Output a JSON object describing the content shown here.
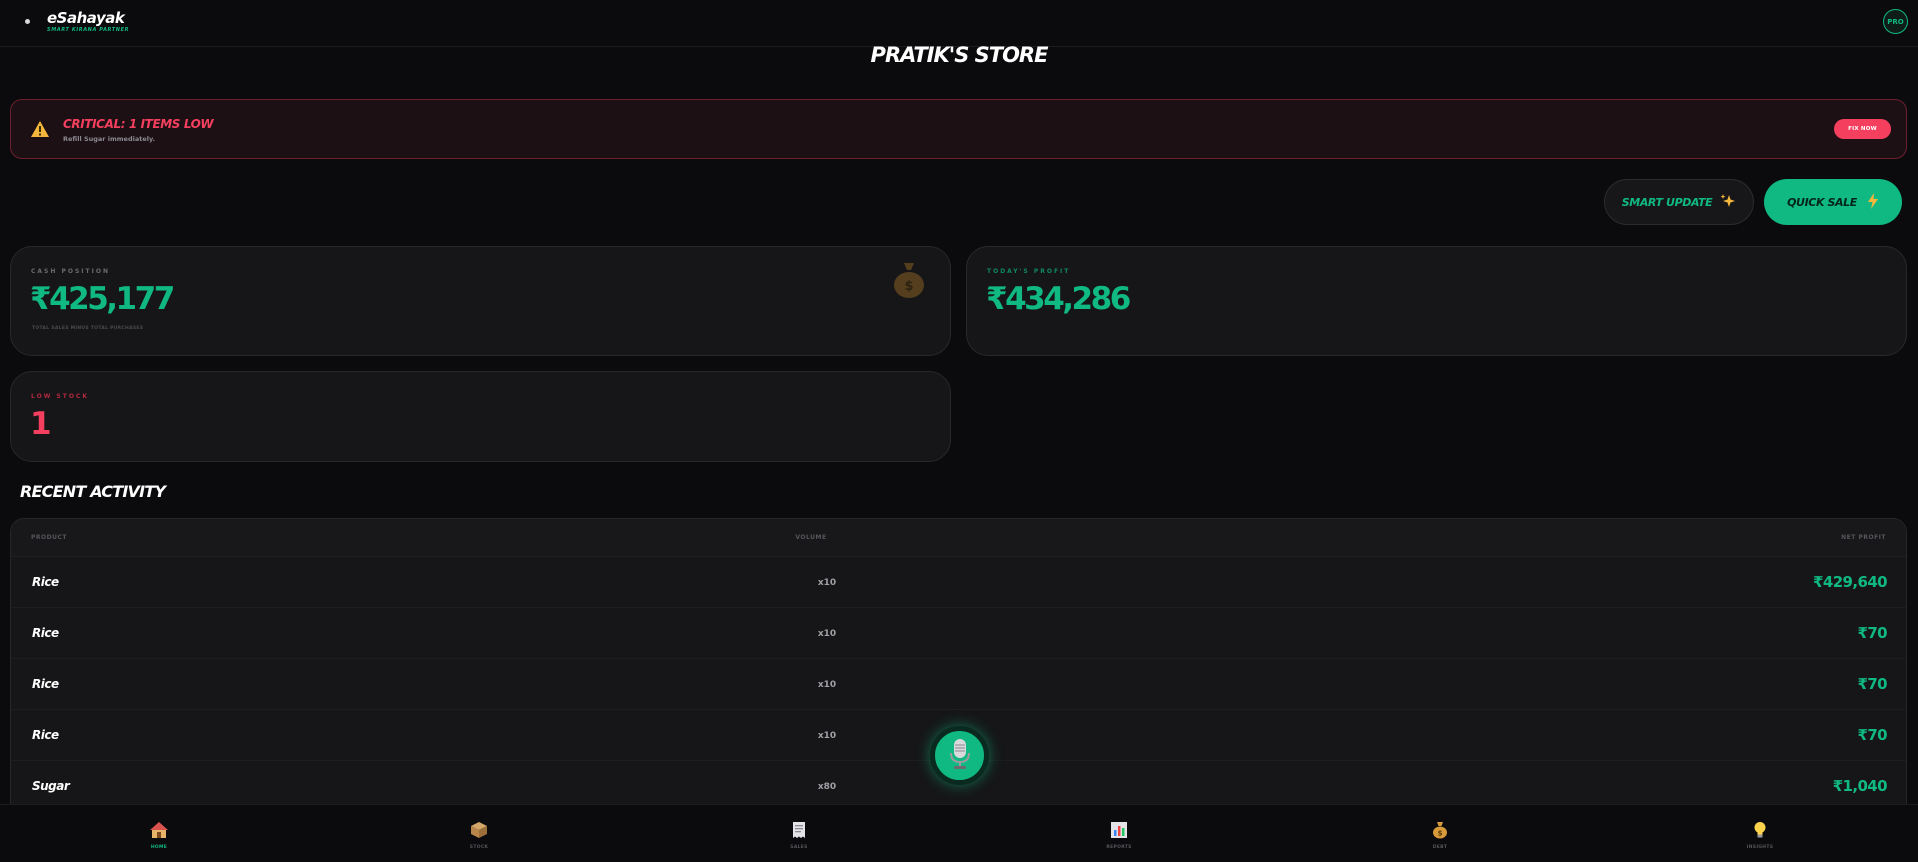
{
  "header": {
    "brand_name": "eSahayak",
    "brand_tagline": "SMART KIRANA PARTNER",
    "pro_badge": "PRO"
  },
  "store": {
    "title": "PRATIK'S STORE"
  },
  "alert": {
    "title": "CRITICAL: 1 ITEMS LOW",
    "subtitle": "Refill Sugar immediately.",
    "fix_label": "FIX NOW"
  },
  "actions": {
    "smart_update_label": "SMART UPDATE",
    "quick_sale_label": "QUICK SALE"
  },
  "stats": {
    "cash": {
      "label": "CASH POSITION",
      "value": "₹425,177",
      "note": "TOTAL SALES MINUS TOTAL PURCHASES"
    },
    "profit": {
      "label": "TODAY'S PROFIT",
      "value": "₹434,286"
    },
    "low_stock": {
      "label": "LOW STOCK",
      "value": "1"
    }
  },
  "activity": {
    "title": "RECENT ACTIVITY",
    "columns": {
      "product": "PRODUCT",
      "volume": "VOLUME",
      "profit": "NET PROFIT"
    },
    "rows": [
      {
        "product": "Rice",
        "volume": "x10",
        "profit": "₹429,640"
      },
      {
        "product": "Rice",
        "volume": "x10",
        "profit": "₹70"
      },
      {
        "product": "Rice",
        "volume": "x10",
        "profit": "₹70"
      },
      {
        "product": "Rice",
        "volume": "x10",
        "profit": "₹70"
      },
      {
        "product": "Sugar",
        "volume": "x80",
        "profit": "₹1,040"
      }
    ]
  },
  "nav": {
    "items": [
      {
        "label": "HOME",
        "icon": "house-icon"
      },
      {
        "label": "STOCK",
        "icon": "package-icon"
      },
      {
        "label": "SALES",
        "icon": "receipt-icon"
      },
      {
        "label": "REPORTS",
        "icon": "chart-icon"
      },
      {
        "label": "DEBT",
        "icon": "moneybag-icon"
      },
      {
        "label": "INSIGHTS",
        "icon": "lightbulb-icon"
      }
    ],
    "active": "HOME"
  },
  "colors": {
    "accent": "#10b981",
    "danger": "#f43f5e",
    "background": "#0b0b0d"
  }
}
